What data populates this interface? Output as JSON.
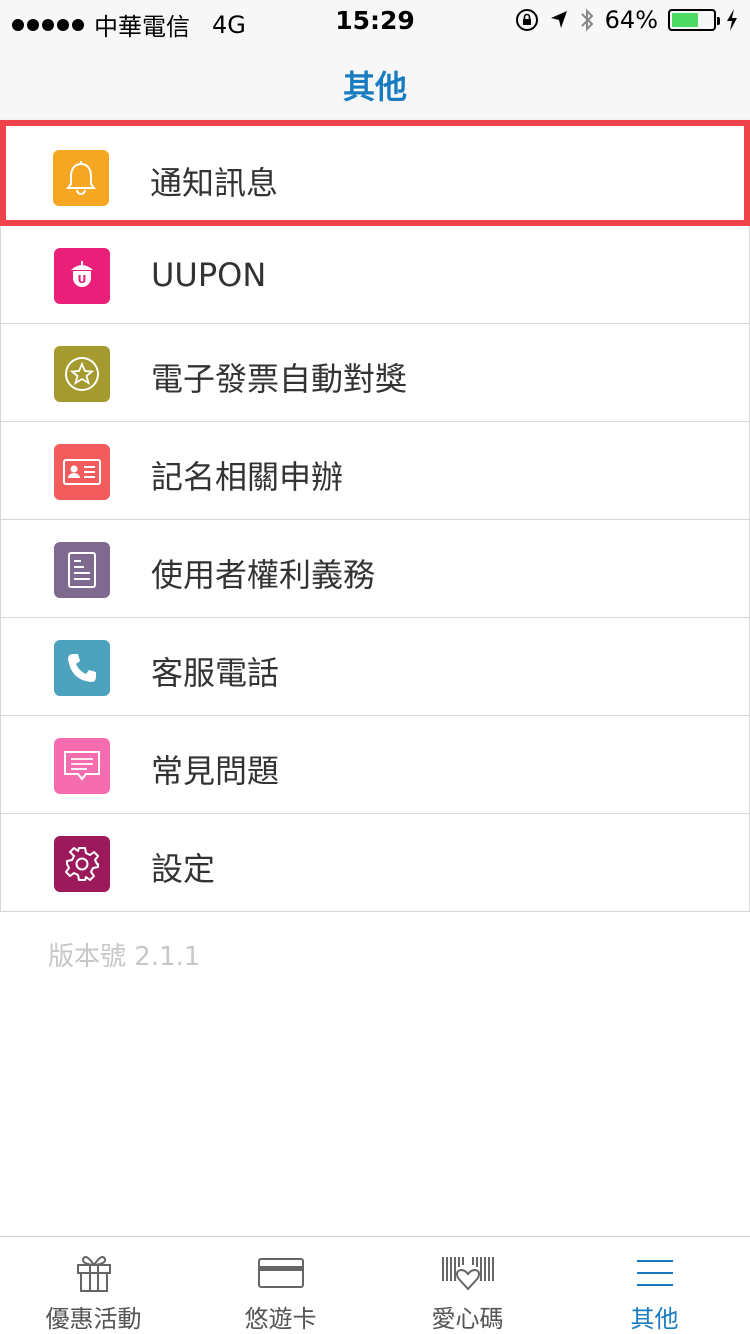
{
  "status_bar": {
    "carrier": "中華電信",
    "network": "4G",
    "time": "15:29",
    "battery": "64%",
    "battery_level": 0.64
  },
  "nav": {
    "title": "其他"
  },
  "menu": {
    "items": [
      {
        "label": "通知訊息",
        "icon": "bell-icon",
        "color": "#f5a623"
      },
      {
        "label": "UUPON",
        "icon": "acorn-icon",
        "color": "#ea1f7a"
      },
      {
        "label": "電子發票自動對獎",
        "icon": "star-badge-icon",
        "color": "#a49a2e"
      },
      {
        "label": "記名相關申辦",
        "icon": "id-card-icon",
        "color": "#f25c5c"
      },
      {
        "label": "使用者權利義務",
        "icon": "document-icon",
        "color": "#7e6a8e"
      },
      {
        "label": "客服電話",
        "icon": "phone-icon",
        "color": "#4da3bd"
      },
      {
        "label": "常見問題",
        "icon": "chat-bubble-icon",
        "color": "#f76cae"
      },
      {
        "label": "設定",
        "icon": "gear-icon",
        "color": "#9c1a5c"
      }
    ]
  },
  "version": "版本號 2.1.1",
  "tabs": [
    {
      "label": "優惠活動",
      "icon": "gift-icon"
    },
    {
      "label": "悠遊卡",
      "icon": "card-icon"
    },
    {
      "label": "愛心碼",
      "icon": "barcode-heart-icon"
    },
    {
      "label": "其他",
      "icon": "menu-lines-icon"
    }
  ],
  "colors": {
    "accent": "#1a7cc0",
    "highlight_border": "#f0424a"
  }
}
